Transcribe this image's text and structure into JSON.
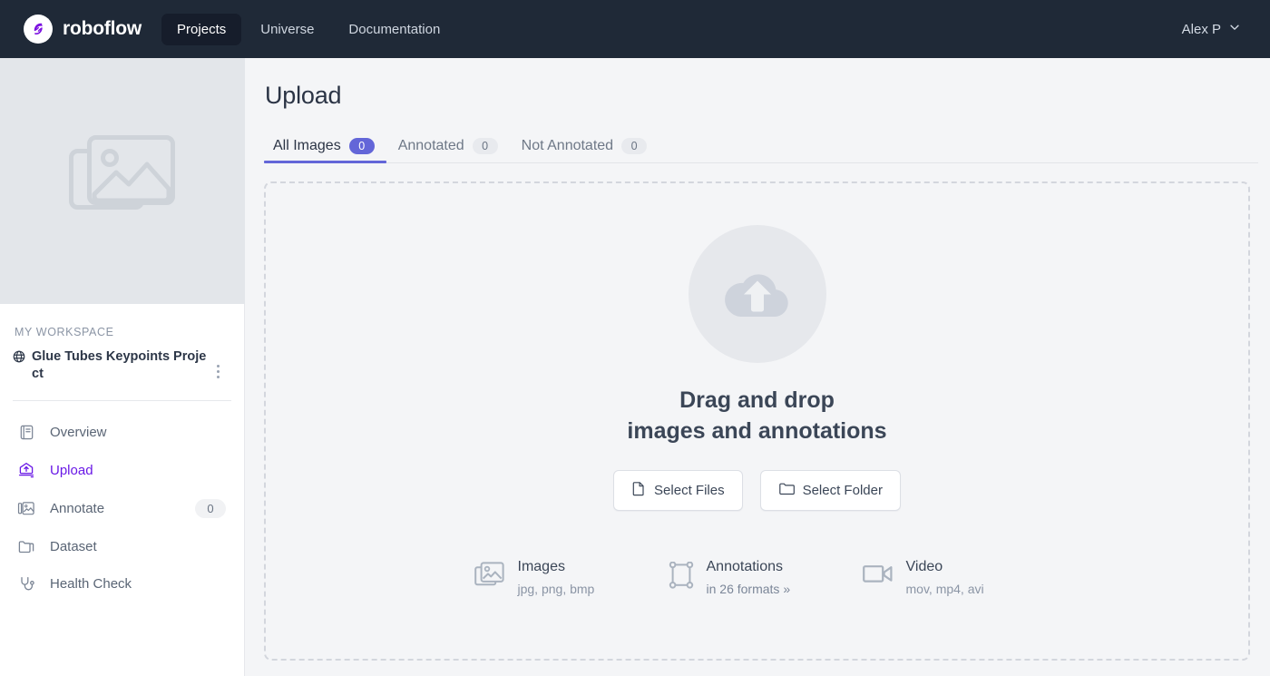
{
  "navbar": {
    "brand_name": "roboflow",
    "brand_icon": "roboflow-logo-icon",
    "links": [
      {
        "label": "Projects",
        "active": true
      },
      {
        "label": "Universe",
        "active": false
      },
      {
        "label": "Documentation",
        "active": false
      }
    ],
    "account_name": "Alex P",
    "account_caret_icon": "chevron-down-icon"
  },
  "sidebar": {
    "thumbnail_icon": "images-placeholder-icon",
    "workspace_label": "MY WORKSPACE",
    "workspace_globe_icon": "globe-icon",
    "project_name": "Glue Tubes Keypoints Project",
    "more_icon": "kebab-menu-icon",
    "items": [
      {
        "label": "Overview",
        "icon": "book-icon",
        "badge": "",
        "selected": false
      },
      {
        "label": "Upload",
        "icon": "upload-icon",
        "badge": "",
        "selected": true
      },
      {
        "label": "Annotate",
        "icon": "annotate-images-icon",
        "badge": "0",
        "selected": false
      },
      {
        "label": "Dataset",
        "icon": "folder-icon",
        "badge": "",
        "selected": false
      },
      {
        "label": "Health Check",
        "icon": "stethoscope-icon",
        "badge": "",
        "selected": false
      }
    ]
  },
  "main": {
    "page_title": "Upload",
    "tabs": [
      {
        "label": "All Images",
        "badge": "0",
        "active": true
      },
      {
        "label": "Annotated",
        "badge": "0",
        "active": false
      },
      {
        "label": "Not Annotated",
        "badge": "0",
        "active": false
      }
    ],
    "dropzone": {
      "cloud_icon": "cloud-upload-icon",
      "title_line1": "Drag and drop",
      "title_line2": "images and annotations",
      "select_files_label": "Select Files",
      "select_files_icon": "file-icon",
      "select_folder_label": "Select Folder",
      "select_folder_icon": "folder-icon",
      "formats": [
        {
          "icon": "images-icon",
          "title": "Images",
          "sub": "jpg, png, bmp",
          "is_link": false
        },
        {
          "icon": "annotation-box-icon",
          "title": "Annotations",
          "sub": "in 26 formats »",
          "is_link": true
        },
        {
          "icon": "video-camera-icon",
          "title": "Video",
          "sub": "mov, mp4, avi",
          "is_link": false
        }
      ]
    }
  },
  "colors": {
    "navbar_bg": "#1f2937",
    "brand_purple": "#7a0ee0",
    "accent_indigo": "#6366d8",
    "active_nav_purple": "#6918e6",
    "main_bg": "#f4f5f7"
  }
}
